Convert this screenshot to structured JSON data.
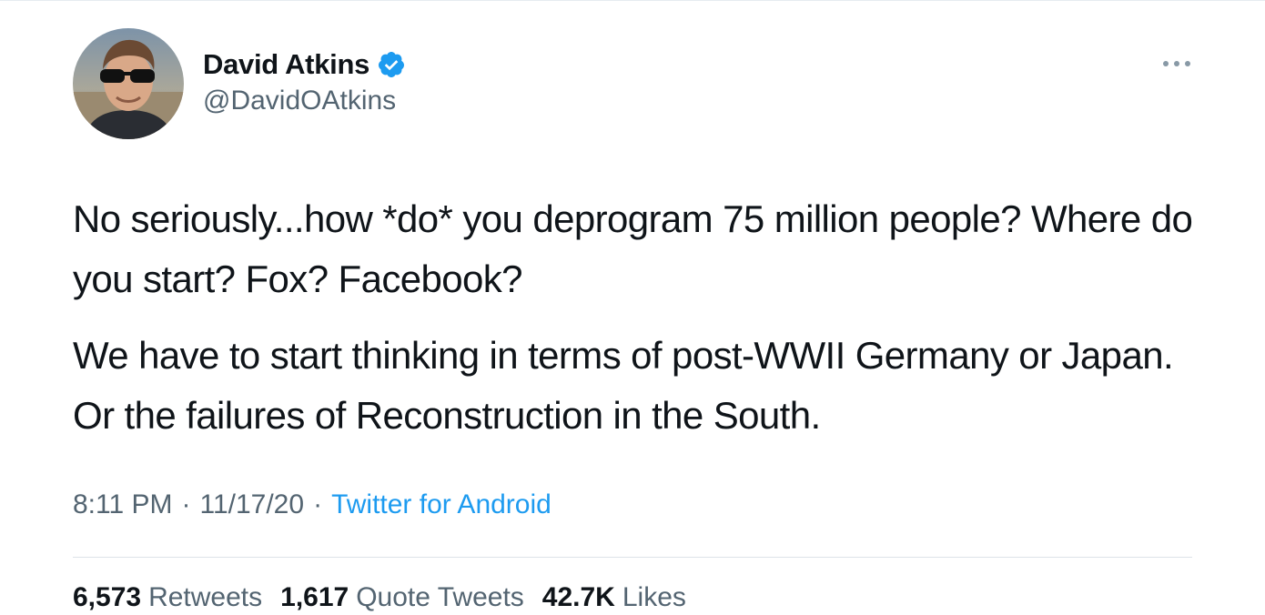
{
  "tweet": {
    "author": {
      "display_name": "David Atkins",
      "handle": "@DavidOAtkins",
      "verified": true,
      "avatar_icon": "profile-photo"
    },
    "more_icon": "ellipsis-icon",
    "paragraphs": [
      "No seriously...how *do* you deprogram 75 million people? Where do you start? Fox? Facebook?",
      "We have to start thinking in terms of post-WWII Germany or Japan. Or the failures of Reconstruction in the South."
    ],
    "meta": {
      "time": "8:11 PM",
      "separator": "·",
      "date": "11/17/20",
      "source": "Twitter for Android"
    },
    "stats": {
      "retweets_count": "6,573",
      "retweets_label": "Retweets",
      "quotes_count": "1,617",
      "quotes_label": "Quote Tweets",
      "likes_count": "42.7K",
      "likes_label": "Likes"
    }
  },
  "colors": {
    "text": "#0f1419",
    "secondary": "#536471",
    "link": "#1d9bf0",
    "verified": "#1d9bf0"
  }
}
